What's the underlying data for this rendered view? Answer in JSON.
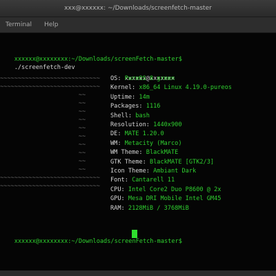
{
  "window": {
    "title": "xxx@xxxxxx: ~/Downloads/screenfetch-master"
  },
  "menubar": {
    "items": [
      "Terminal",
      "Help"
    ]
  },
  "terminal": {
    "command_prompt": "xxxxxx@xxxxxxxx:~/Downloads/screenFetch-master$",
    "command": "./screenfetch-dev",
    "end_prompt": "xxxxxx@xxxxxxxx:~/Downloads/screenFetch-master$",
    "user_host": "xxxxxx@xxxxxxx",
    "info": [
      {
        "key": "OS:",
        "value": "PureOS 8 green"
      },
      {
        "key": "Kernel:",
        "value": "x86_64 Linux 4.19.0-pureos"
      },
      {
        "key": "Uptime:",
        "value": "14m"
      },
      {
        "key": "Packages:",
        "value": "1116"
      },
      {
        "key": "Shell:",
        "value": "bash"
      },
      {
        "key": "Resolution:",
        "value": "1440x900"
      },
      {
        "key": "DE:",
        "value": "MATE 1.20.0"
      },
      {
        "key": "WM:",
        "value": "Metacity (Marco)"
      },
      {
        "key": "WM Theme:",
        "value": "BlackMATE"
      },
      {
        "key": "GTK Theme:",
        "value": "BlackMATE [GTK2/3]"
      },
      {
        "key": "Icon Theme:",
        "value": "Ambiant Dark"
      },
      {
        "key": "Font:",
        "value": "Cantarell 11"
      },
      {
        "key": "CPU:",
        "value": "Intel Core2 Duo P8600 @ 2x"
      },
      {
        "key": "GPU:",
        "value": "Mesa DRI Mobile Intel GM45"
      },
      {
        "key": "RAM:",
        "value": "2128MiB / 3768MiB"
      }
    ]
  }
}
